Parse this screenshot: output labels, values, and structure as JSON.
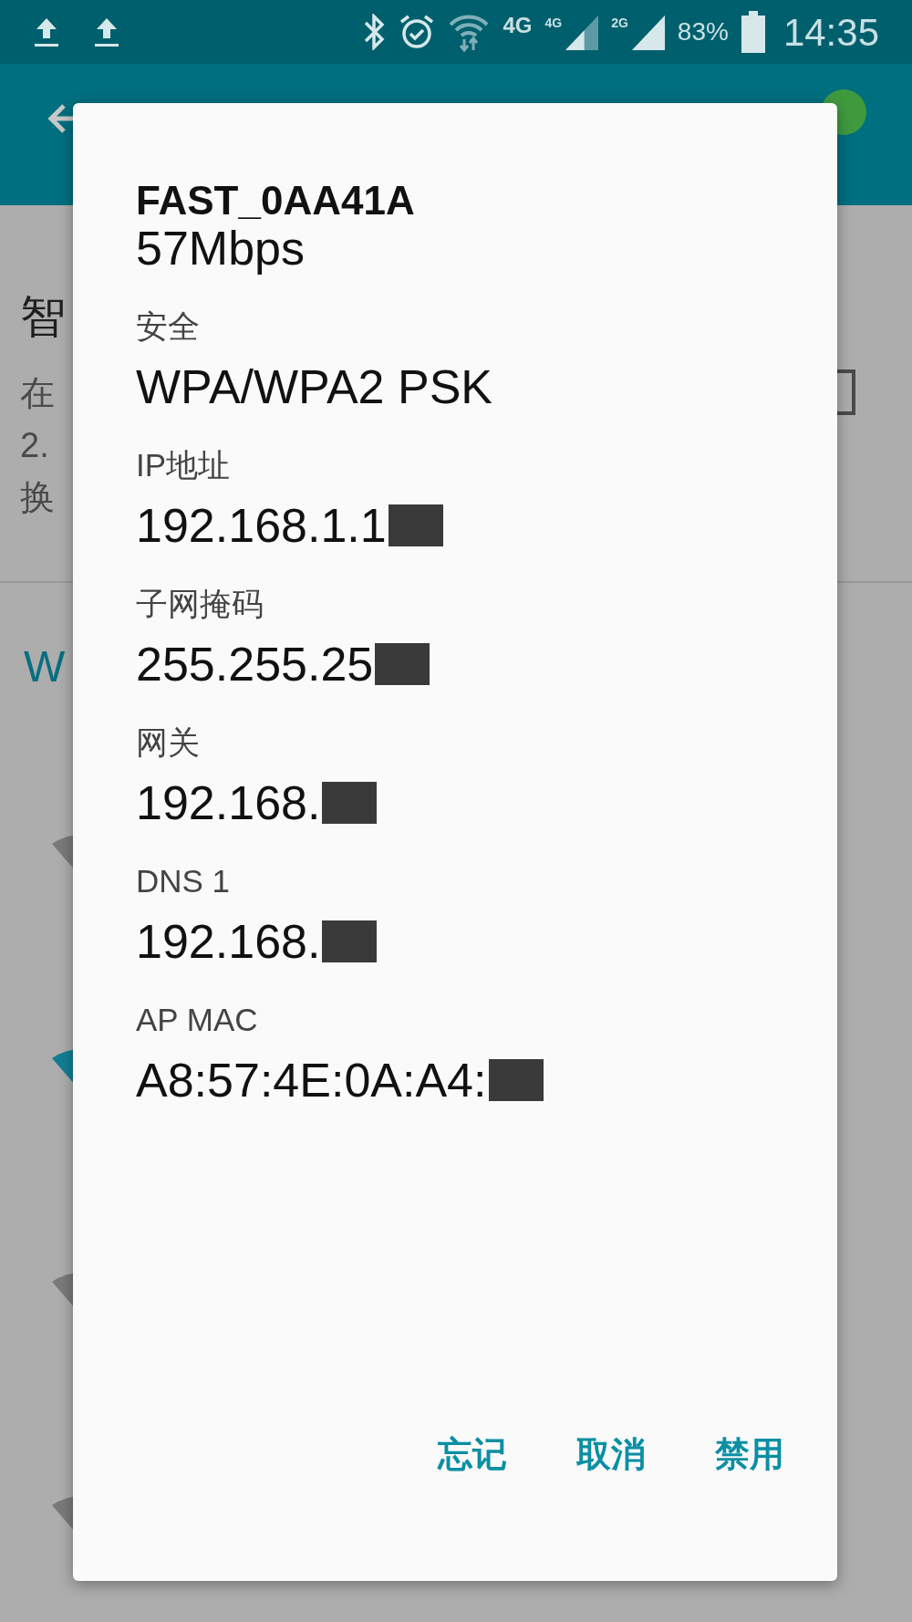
{
  "header": {
    "switch_on": true,
    "checkbox_checked": false
  },
  "status_bar": {
    "network": "4G",
    "sim_1": "4G",
    "sim_2": "2G",
    "battery": "83%",
    "time": "14:35"
  },
  "background": {
    "section_title": "智",
    "description_lines": [
      "在",
      "2.",
      "换"
    ],
    "list_header": "W",
    "wifi_list": [
      {
        "connected": false
      },
      {
        "connected": true
      },
      {
        "connected": false
      },
      {
        "connected": false
      }
    ]
  },
  "dialog": {
    "title": "FAST_0AA41A",
    "speed": "57Mbps",
    "fields": [
      {
        "label": "安全",
        "value": "WPA/WPA2 PSK",
        "redacted": false
      },
      {
        "label": "IP地址",
        "value": "192.168.1.1",
        "redacted": true
      },
      {
        "label": "子网掩码",
        "value": "255.255.25",
        "redacted": true
      },
      {
        "label": "网关",
        "value": "192.168.",
        "redacted": true
      },
      {
        "label": "DNS 1",
        "value": "192.168.",
        "redacted": true
      },
      {
        "label": "AP MAC",
        "value": "A8:57:4E:0A:A4:",
        "redacted": true
      }
    ],
    "buttons": [
      "忘记",
      "取消",
      "禁用"
    ]
  }
}
